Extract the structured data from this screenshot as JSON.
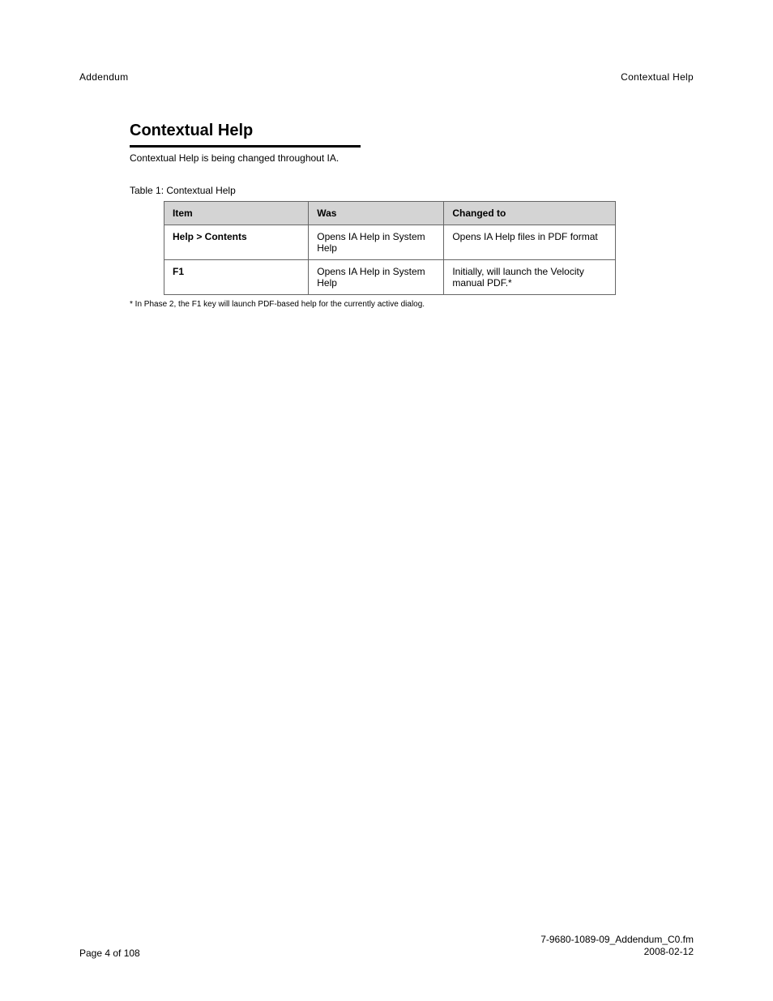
{
  "header": {
    "left": "Addendum",
    "right": "Contextual Help"
  },
  "section": {
    "heading": "Contextual Help",
    "intro": "Contextual Help is being changed throughout IA.",
    "table_caption": "Table 1:  Contextual Help"
  },
  "table": {
    "headers": [
      "Item",
      "Was",
      "Changed to"
    ],
    "rows": [
      {
        "item": "Help > Contents",
        "was": "Opens IA Help in System Help",
        "changed": "Opens IA Help files in PDF format"
      },
      {
        "item": "F1",
        "was": "Opens IA Help in System Help",
        "changed": "Initially, will launch the Velocity manual PDF.*"
      }
    ]
  },
  "footnote": "* In Phase 2, the F1 key will launch PDF-based help for the currently active dialog.",
  "footer": {
    "page": "Page 4 of 108",
    "doc_line1": "7-9680-1089-09_Addendum_C0.fm",
    "doc_line2": "2008-02-12"
  }
}
